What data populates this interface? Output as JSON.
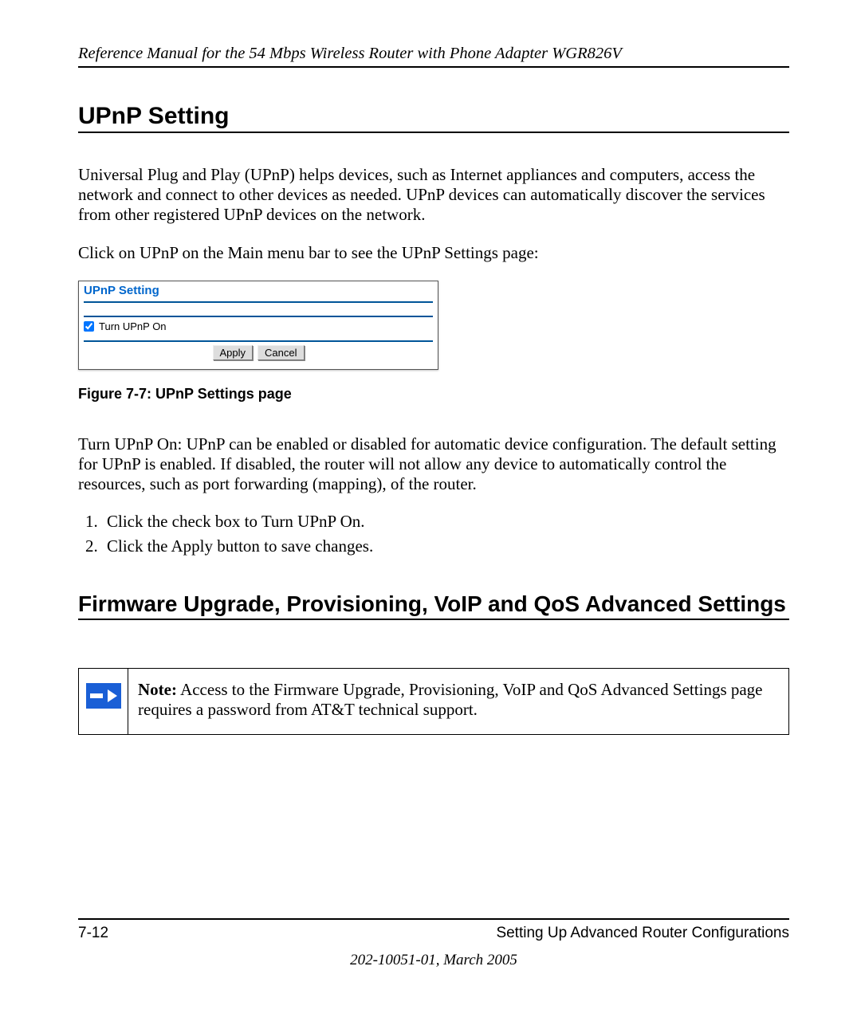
{
  "header": {
    "running_title": "Reference Manual for the 54 Mbps Wireless Router with Phone Adapter WGR826V"
  },
  "section1": {
    "title": "UPnP Setting",
    "para1": "Universal Plug and Play (UPnP) helps devices, such as Internet appliances and computers, access the network and connect to other devices as needed. UPnP devices can automatically discover the services from other registered UPnP devices on the network.",
    "para2": "Click on UPnP on the Main menu bar to see the UPnP Settings page:"
  },
  "ui_panel": {
    "title": "UPnP Setting",
    "checkbox_label": "Turn UPnP On",
    "checkbox_checked": true,
    "apply_label": "Apply",
    "cancel_label": "Cancel"
  },
  "figure_caption": "Figure 7-7:  UPnP Settings page",
  "section1b": {
    "para3": "Turn UPnP On: UPnP can be enabled or disabled for automatic device configuration. The default setting for UPnP is enabled. If disabled, the router will not allow any device to automatically control the resources, such as port forwarding (mapping), of the router.",
    "steps": [
      "Click the check box to Turn UPnP On.",
      "Click the Apply button to save changes."
    ]
  },
  "section2": {
    "title": "Firmware Upgrade, Provisioning, VoIP and QoS Advanced Settings"
  },
  "note": {
    "label": "Note:",
    "text": " Access to the Firmware Upgrade, Provisioning, VoIP and QoS Advanced Settings page requires a password from AT&T technical support."
  },
  "footer": {
    "page_num": "7-12",
    "chapter": "Setting Up Advanced Router Configurations",
    "doc_id": "202-10051-01, March 2005"
  }
}
